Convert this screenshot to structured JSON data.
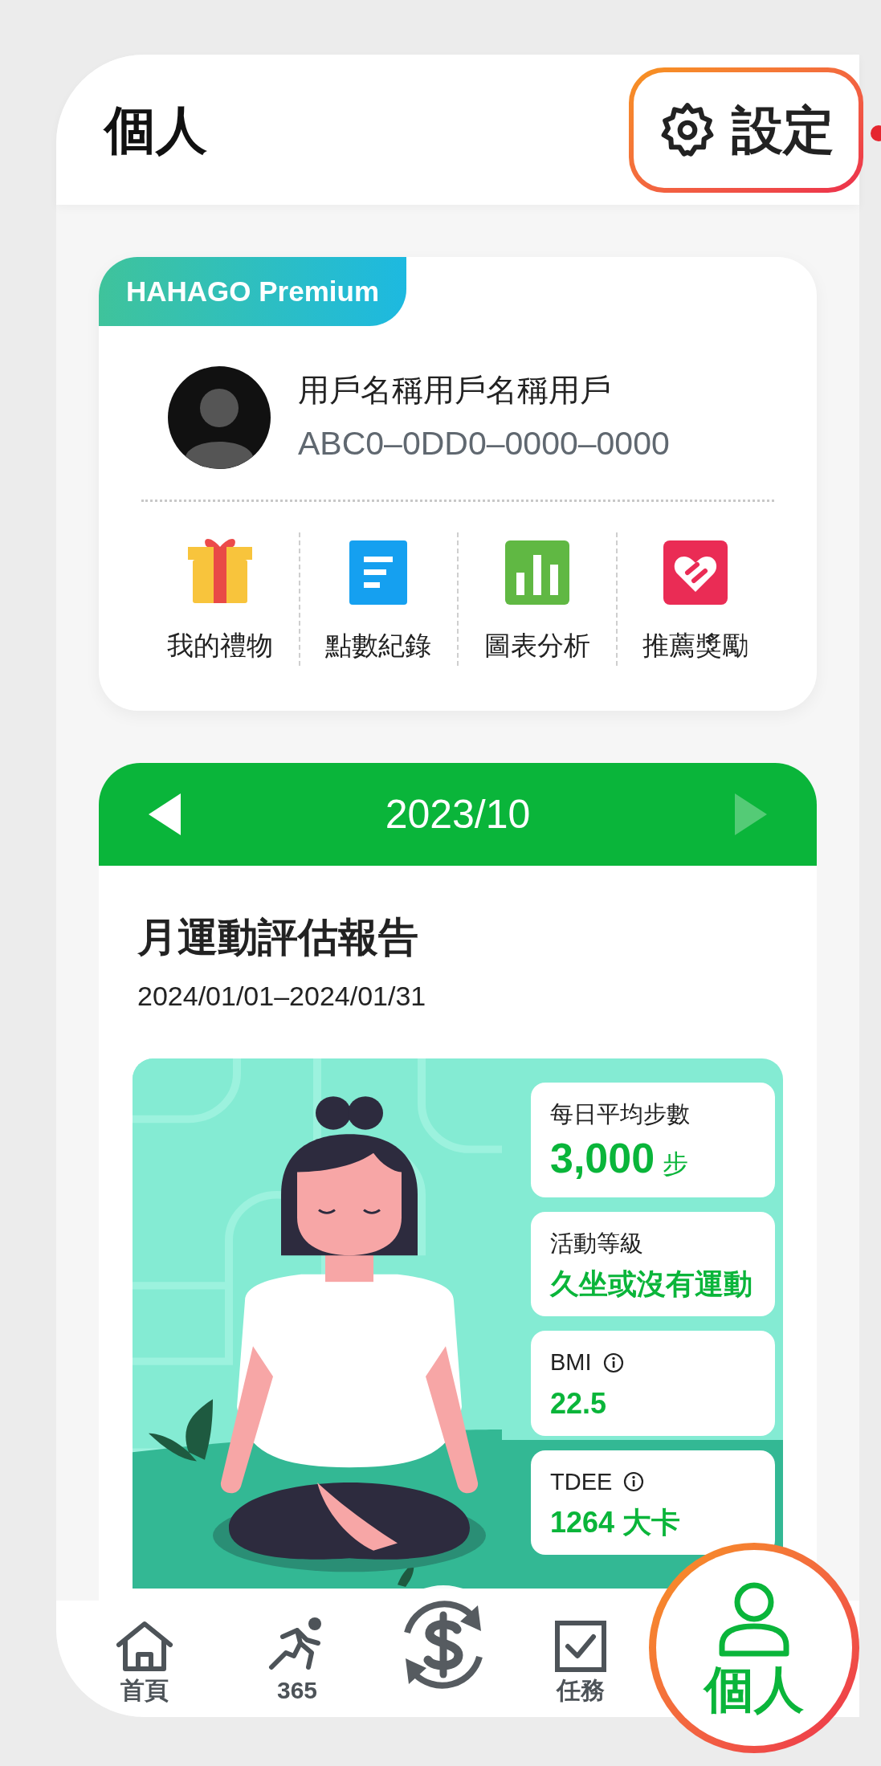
{
  "header": {
    "title": "個人",
    "settings_button": "設定"
  },
  "profile": {
    "badge": "HAHAGO Premium",
    "name": "用戶名稱用戶名稱用戶",
    "id": "ABC0–0DD0–0000–0000",
    "shortcuts": [
      {
        "kind": "gift",
        "label": "我的禮物"
      },
      {
        "kind": "records",
        "label": "點數紀錄"
      },
      {
        "kind": "chart",
        "label": "圖表分析"
      },
      {
        "kind": "referral",
        "label": "推薦獎勵"
      }
    ]
  },
  "report": {
    "month": "2023/10",
    "prev_disabled": false,
    "next_disabled": true,
    "title": "月運動評估報告",
    "date_range": "2024/01/01–2024/01/31",
    "stats": [
      {
        "kind": "big",
        "label": "每日平均步數",
        "value": "3,000",
        "unit": "步",
        "info": false
      },
      {
        "kind": "text",
        "label": "活動等級",
        "value": "久坐或沒有運動",
        "info": false
      },
      {
        "kind": "text",
        "label": "BMI",
        "value": "22.5",
        "info": true
      },
      {
        "kind": "text",
        "label": "TDEE",
        "value": "1264 大卡",
        "info": true
      }
    ]
  },
  "nav": [
    {
      "kind": "home",
      "label": "首頁",
      "selected": false
    },
    {
      "kind": "run",
      "label": "365",
      "selected": false
    },
    {
      "kind": "exchange",
      "selected": false
    },
    {
      "kind": "tasks",
      "label": "任務",
      "selected": false
    },
    {
      "kind": "person",
      "label": "個人",
      "selected": true
    }
  ]
}
